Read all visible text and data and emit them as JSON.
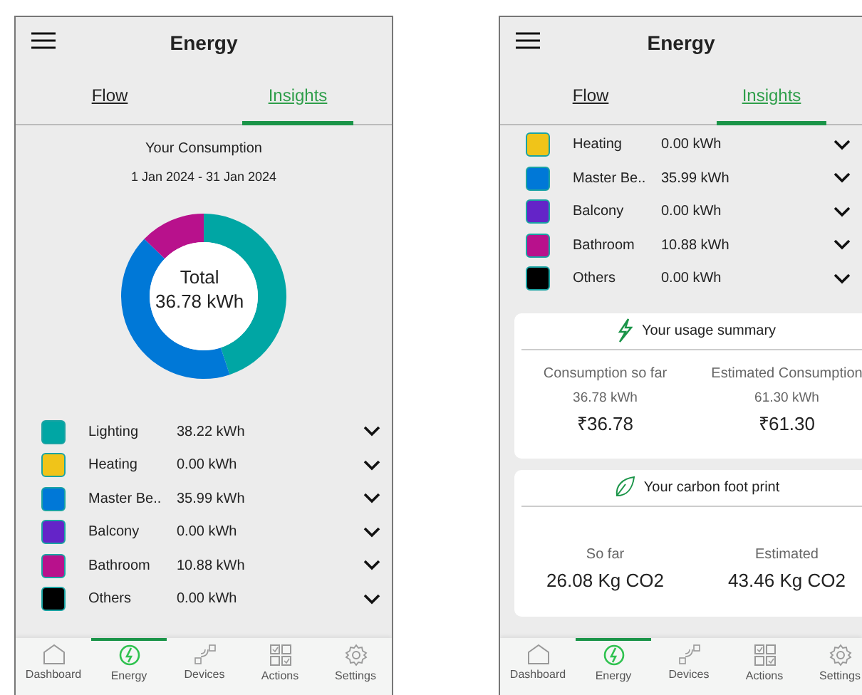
{
  "screens": [
    {
      "header": {
        "title": "Energy"
      },
      "tabs": [
        {
          "label": "Flow",
          "selected": false
        },
        {
          "label": "Insights",
          "selected": true
        }
      ],
      "consumption": {
        "title": "Your Consumption",
        "date_range": "1 Jan 2024 - 31 Jan 2024",
        "center_label": "Total",
        "center_value": "36.78 kWh"
      },
      "rooms": [
        {
          "name": "Lighting",
          "value": "38.22 kWh",
          "color": "#00a6a4"
        },
        {
          "name": "Heating",
          "value": "0.00 kWh",
          "color": "#f0c419"
        },
        {
          "name": "Master Be..",
          "value": "35.99 kWh",
          "color": "#0078d7"
        },
        {
          "name": "Balcony",
          "value": "0.00 kWh",
          "color": "#6424c8"
        },
        {
          "name": "Bathroom",
          "value": "10.88 kWh",
          "color": "#b8118c"
        },
        {
          "name": "Others",
          "value": "0.00 kWh",
          "color": "#000000"
        }
      ],
      "nav": [
        {
          "label": "Dashboard",
          "selected": false
        },
        {
          "label": "Energy",
          "selected": true
        },
        {
          "label": "Devices",
          "selected": false
        },
        {
          "label": "Actions",
          "selected": false
        },
        {
          "label": "Settings",
          "selected": false
        }
      ]
    },
    {
      "header": {
        "title": "Energy"
      },
      "tabs": [
        {
          "label": "Flow",
          "selected": false
        },
        {
          "label": "Insights",
          "selected": true
        }
      ],
      "rooms": [
        {
          "name": "Heating",
          "value": "0.00 kWh",
          "color": "#f0c419"
        },
        {
          "name": "Master Be..",
          "value": "35.99 kWh",
          "color": "#0078d7"
        },
        {
          "name": "Balcony",
          "value": "0.00 kWh",
          "color": "#6424c8"
        },
        {
          "name": "Bathroom",
          "value": "10.88 kWh",
          "color": "#b8118c"
        },
        {
          "name": "Others",
          "value": "0.00 kWh",
          "color": "#000000"
        }
      ],
      "cards": [
        {
          "kind": "usage",
          "title": "Your usage summary",
          "columns": [
            {
              "label": "Consumption so far",
              "sub": "36.78 kWh",
              "value": "₹36.78"
            },
            {
              "label": "Estimated Consumption",
              "sub": "61.30 kWh",
              "value": "₹61.30"
            }
          ]
        },
        {
          "kind": "carbon",
          "title": "Your carbon foot print",
          "columns": [
            {
              "label": "So far",
              "value": "26.08 Kg CO2"
            },
            {
              "label": "Estimated",
              "value": "43.46 Kg CO2"
            }
          ]
        }
      ],
      "nav": [
        {
          "label": "Dashboard",
          "selected": false
        },
        {
          "label": "Energy",
          "selected": true
        },
        {
          "label": "Devices",
          "selected": false
        },
        {
          "label": "Actions",
          "selected": false
        },
        {
          "label": "Settings",
          "selected": false
        }
      ]
    }
  ]
}
